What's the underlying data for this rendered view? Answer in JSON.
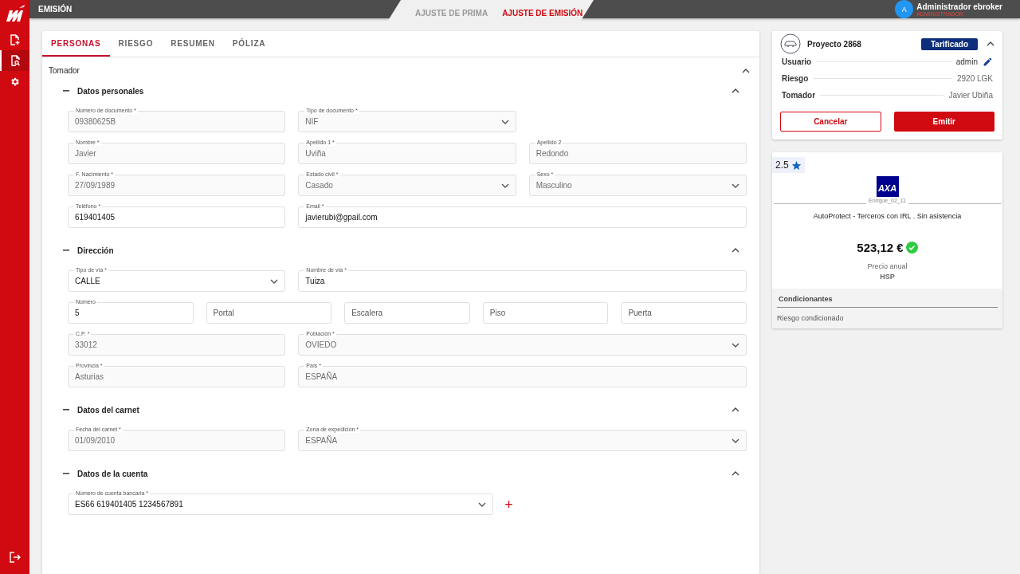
{
  "topbar": {
    "title": "EMISIÓN",
    "steps": [
      {
        "label": "AJUSTE DE PRIMA",
        "selected": false
      },
      {
        "label": "AJUSTE DE EMISIÓN",
        "selected": true
      }
    ],
    "user": {
      "initial": "A",
      "name": "Administrador ebroker",
      "role": "ADMINISTRADOR"
    }
  },
  "sidebar": {
    "items": [
      {
        "kind": "new",
        "selected": false
      },
      {
        "kind": "search",
        "selected": true
      },
      {
        "kind": "settings",
        "selected": false
      }
    ]
  },
  "tabs": [
    {
      "label": "PERSONAS",
      "selected": true
    },
    {
      "label": "RIESGO",
      "selected": false
    },
    {
      "label": "RESUMEN",
      "selected": false
    },
    {
      "label": "PÓLIZA",
      "selected": false
    }
  ],
  "panel": {
    "title": "Tomador",
    "expanded": true,
    "sections": [
      {
        "title": "Datos personales",
        "expanded": true,
        "rows": [
          [
            {
              "label": "Número de documento *",
              "value": "09380625B",
              "kind": "text",
              "disabled": true,
              "wide": false
            },
            {
              "label": "Tipo de documento *",
              "value": "NIF",
              "kind": "select",
              "disabled": true,
              "wide": false
            }
          ],
          [
            {
              "label": "Nombre *",
              "value": "Javier",
              "kind": "text",
              "disabled": true,
              "wide": false
            },
            {
              "label": "Apellido 1 *",
              "value": "Uviña",
              "kind": "text",
              "disabled": true,
              "wide": false
            },
            {
              "label": "Apellido 2",
              "value": "Redondo",
              "kind": "text",
              "disabled": true,
              "wide": false
            }
          ],
          [
            {
              "label": "F. Nacimiento *",
              "value": "27/09/1989",
              "kind": "text",
              "disabled": true,
              "wide": false
            },
            {
              "label": "Estado civil *",
              "value": "Casado",
              "kind": "select",
              "disabled": true,
              "wide": false
            },
            {
              "label": "Sexo *",
              "value": "Masculino",
              "kind": "select",
              "disabled": true,
              "wide": false
            }
          ],
          [
            {
              "label": "Teléfono *",
              "value": "619401405",
              "kind": "text",
              "disabled": false,
              "wide": false
            },
            {
              "label": "Email *",
              "value": "javierubi@gpail.com",
              "kind": "text",
              "disabled": false,
              "wide": true
            }
          ]
        ]
      },
      {
        "title": "Dirección",
        "expanded": true,
        "rows": [
          [
            {
              "label": "Tipo de vía *",
              "value": "CALLE",
              "kind": "select",
              "disabled": false,
              "wide": false
            },
            {
              "label": "Nombre de vía *",
              "value": "Tuiza",
              "kind": "text",
              "disabled": false,
              "wide": true
            }
          ],
          [
            {
              "label": "Número",
              "value": "5",
              "kind": "text",
              "disabled": false,
              "wide": false
            },
            {
              "placeholder": "Portal",
              "kind": "text",
              "disabled": false,
              "wide": false
            },
            {
              "placeholder": "Escalera",
              "kind": "text",
              "disabled": false,
              "wide": false
            },
            {
              "placeholder": "Piso",
              "kind": "text",
              "disabled": false,
              "wide": false
            },
            {
              "placeholder": "Puerta",
              "kind": "text",
              "disabled": false,
              "wide": false
            }
          ],
          [
            {
              "label": "C.P. *",
              "value": "33012",
              "kind": "text",
              "disabled": true,
              "wide": false
            },
            {
              "label": "Población *",
              "value": "OVIEDO",
              "kind": "select",
              "disabled": true,
              "wide": true
            }
          ],
          [
            {
              "label": "Provincia *",
              "value": "Asturias",
              "kind": "text",
              "disabled": true,
              "wide": false
            },
            {
              "label": "País *",
              "value": "ESPAÑA",
              "kind": "text",
              "disabled": true,
              "wide": true
            }
          ]
        ]
      },
      {
        "title": "Datos del carnet",
        "expanded": true,
        "rows": [
          [
            {
              "label": "Fecha del carnet *",
              "value": "01/09/2010",
              "kind": "text",
              "disabled": true,
              "wide": false
            },
            {
              "label": "Zona de expedición *",
              "value": "ESPAÑA",
              "kind": "select",
              "disabled": true,
              "wide": true
            }
          ]
        ]
      },
      {
        "title": "Datos de la cuenta",
        "expanded": true,
        "rows": [
          [
            {
              "label": "Número de cuenta bancaria *",
              "value": "ES66 619401405  1234567891",
              "kind": "account",
              "disabled": false,
              "wide": true,
              "action": "+"
            }
          ]
        ]
      }
    ]
  },
  "project": {
    "title": "Proyecto 2868",
    "status": "Tarificado",
    "expanded": true,
    "rows": [
      {
        "label": "Usuario",
        "value": "admin",
        "editable": true
      },
      {
        "label": "Riesgo",
        "value": "2920 LGK",
        "editable": false
      },
      {
        "label": "Tomador",
        "value": "Javier Ubiña",
        "editable": false
      }
    ],
    "buttons": [
      {
        "label": "Cancelar",
        "kind": "secondary"
      },
      {
        "label": "Emitir",
        "kind": "primary"
      }
    ]
  },
  "offer": {
    "rating": "2.5",
    "logo": "AXA",
    "agent": "Enrique_02_11",
    "product": "AutoProtect - Terceros con IRL . Sin asistencia",
    "price": "523,12 €",
    "price_label": "Precio anual",
    "code": "HSP",
    "conditions_title": "Condicionantes",
    "conditions": [
      "Riesgo condicionado"
    ]
  }
}
